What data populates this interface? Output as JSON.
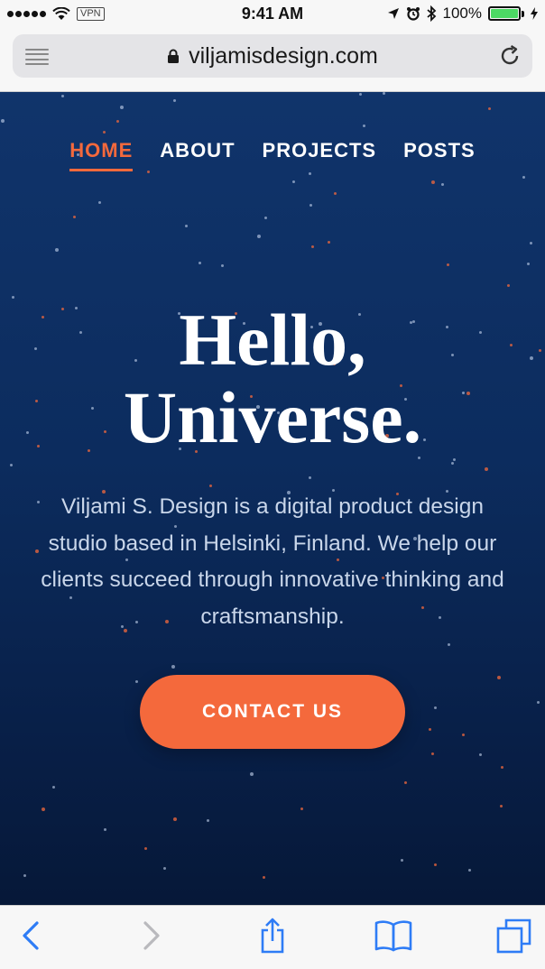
{
  "status_bar": {
    "carrier_vpn": "VPN",
    "time": "9:41 AM",
    "battery_percent": "100%",
    "battery_level": 1.0
  },
  "browser": {
    "url": "viljamisdesign.com"
  },
  "site": {
    "nav": [
      {
        "label": "HOME",
        "active": true
      },
      {
        "label": "ABOUT",
        "active": false
      },
      {
        "label": "PROJECTS",
        "active": false
      },
      {
        "label": "POSTS",
        "active": false
      }
    ],
    "headline_line1": "Hello,",
    "headline_line2": "Universe.",
    "intro": "Viljami S. Design is a digital product design studio based in Helsinki, Finland. We help our clients succeed through innovative thinking and craftsmanship.",
    "cta_label": "CONTACT US"
  },
  "colors": {
    "accent": "#f4693c",
    "hero_bg": "#0c2c5e",
    "ios_blue": "#2e7cf6"
  },
  "toolbar_icons": [
    "back-icon",
    "forward-icon",
    "share-icon",
    "bookmarks-icon",
    "tabs-icon"
  ]
}
